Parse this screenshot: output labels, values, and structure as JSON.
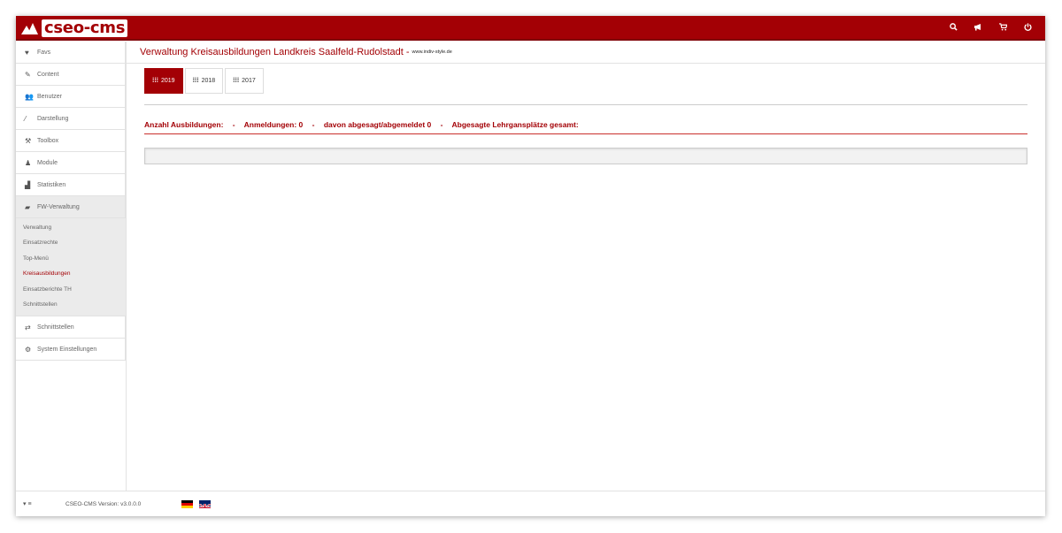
{
  "app": {
    "logo_text": "cseo-cms"
  },
  "topbar": {
    "icons": [
      "search-icon",
      "megaphone-icon",
      "cart-icon",
      "power-icon"
    ]
  },
  "sidebar": {
    "items": [
      {
        "label": "Favs",
        "icon": "heart-icon"
      },
      {
        "label": "Content",
        "icon": "pencil-icon"
      },
      {
        "label": "Benutzer",
        "icon": "users-icon"
      },
      {
        "label": "Darstellung",
        "icon": "brush-icon"
      },
      {
        "label": "Toolbox",
        "icon": "wrench-icon"
      },
      {
        "label": "Module",
        "icon": "puzzle-icon"
      },
      {
        "label": "Statistiken",
        "icon": "area-chart-icon"
      },
      {
        "label": "FW-Verwaltung",
        "icon": "folder-open-icon"
      }
    ],
    "submenu": [
      "Verwaltung",
      "Einsatzrechte",
      "Top-Menü",
      "Kreisausbildungen",
      "Einsatzberichte TH",
      "Schnittstellen"
    ],
    "items_after": [
      {
        "label": "Schnittstellen",
        "icon": "exchange-icon"
      },
      {
        "label": "System Einstellungen",
        "icon": "cogs-icon"
      }
    ]
  },
  "main": {
    "title": "Verwaltung Kreisausbildungen Landkreis Saalfeld-Rudolstadt -",
    "subtitle": "www.indiv-style.de",
    "tabs": [
      "2019",
      "2018",
      "2017"
    ],
    "summary": {
      "anzahl": "Anzahl Ausbildungen:",
      "anmeldungen": "Anmeldungen: 0",
      "abgesagt": "davon abgesagt/abgemeldet 0",
      "lehrgang": "Abgesagte Lehrgansplätze gesamt:",
      "separator": "-"
    }
  },
  "footer": {
    "menu_toggle": "▾ ≡",
    "version": "CSEO-CMS Version: v3.0.0.0"
  },
  "colors": {
    "brand": "#a30005",
    "sidebar_active": "#ebebeb"
  }
}
